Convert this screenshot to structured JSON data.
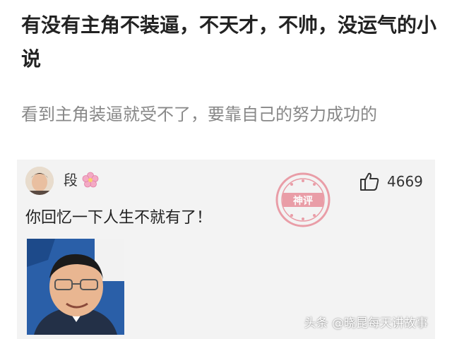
{
  "question": {
    "title": "有没有主角不装逼，不天才，不帅，没运气的小说",
    "description": "看到主角装逼就受不了，要靠自己的努力成功的"
  },
  "answer": {
    "author_name": "段",
    "author_emoji_icon": "cherry-blossom-icon",
    "likes": "4669",
    "like_icon": "thumbs-up-icon",
    "stamp_text": "神评",
    "text": "你回忆一下人生不就有了！"
  },
  "watermark": "头条 @晓昆每天讲故事",
  "colors": {
    "card_background": "#f3f3f3",
    "stamp": "#e8949f",
    "meme_background": "#2a5fa8"
  }
}
